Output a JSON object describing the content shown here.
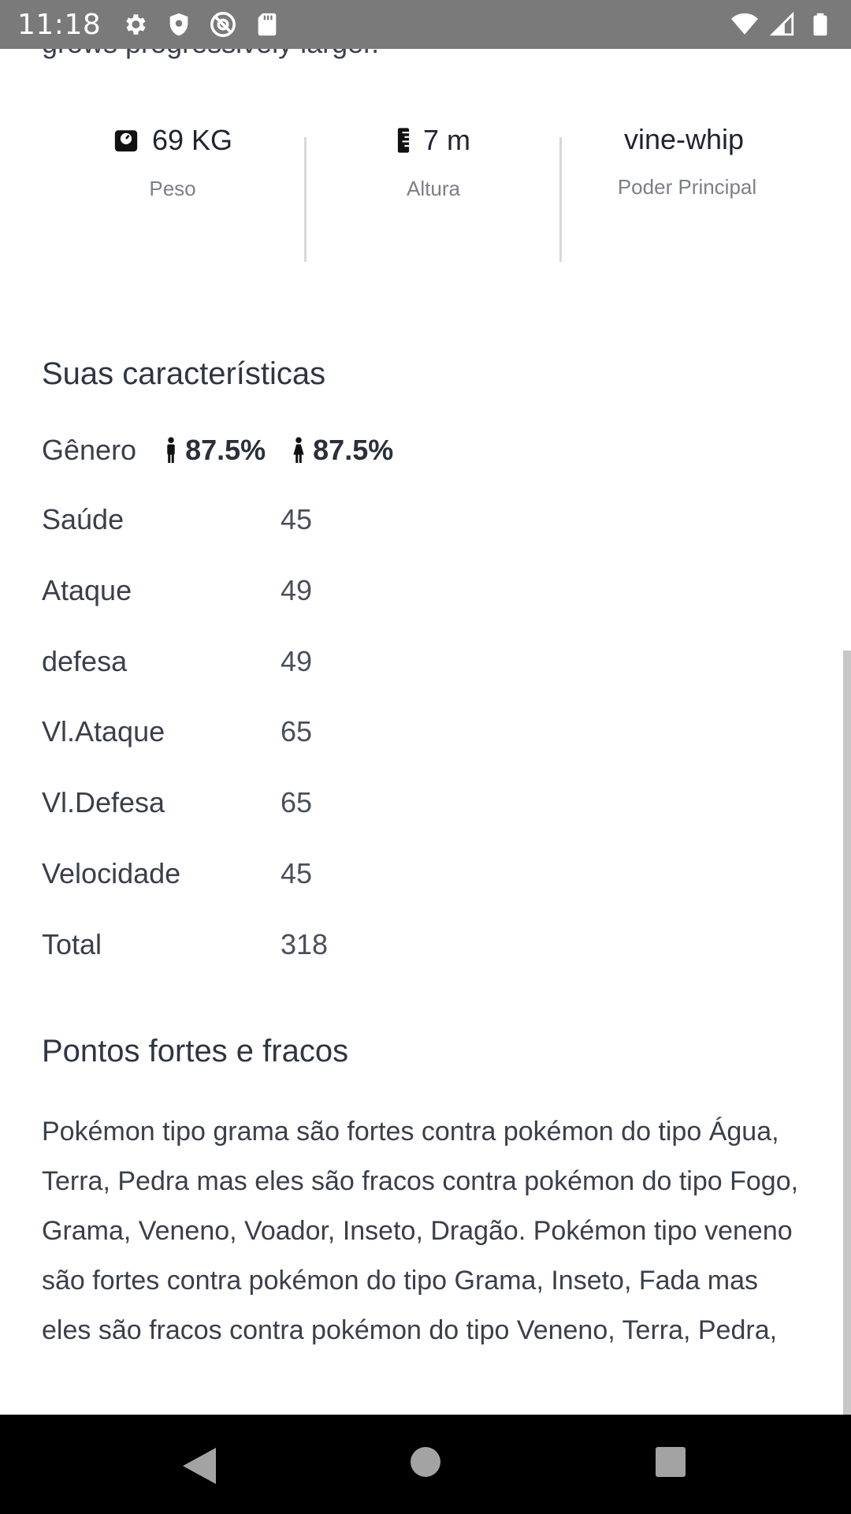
{
  "status_bar": {
    "time": "11:18",
    "icons_left": [
      "gear-icon",
      "shield-icon",
      "at-sign-icon",
      "sd-card-icon"
    ],
    "icons_right": [
      "wifi-icon",
      "signal-icon",
      "battery-icon"
    ]
  },
  "description_clipped": "grows progressively larger.",
  "stats": {
    "weight": {
      "value": "69 KG",
      "label": "Peso",
      "icon": "scale-icon"
    },
    "height": {
      "value": "7 m",
      "label": "Altura",
      "icon": "ruler-icon"
    },
    "power": {
      "value": "vine-whip",
      "label": "Poder Principal"
    }
  },
  "characteristics": {
    "title": "Suas características",
    "gender_label": "Gênero",
    "gender_male": "87.5%",
    "gender_female": "87.5%",
    "attributes": [
      {
        "name": "Saúde",
        "value": "45"
      },
      {
        "name": "Ataque",
        "value": "49"
      },
      {
        "name": "defesa",
        "value": "49"
      },
      {
        "name": "Vl.Ataque",
        "value": "65"
      },
      {
        "name": "Vl.Defesa",
        "value": "65"
      },
      {
        "name": "Velocidade",
        "value": "45"
      },
      {
        "name": "Total",
        "value": "318"
      }
    ]
  },
  "strengths": {
    "title": "Pontos fortes e fracos",
    "text": "Pokémon tipo grama são fortes contra pokémon do tipo Água, Terra, Pedra mas eles são fracos contra pokémon do tipo Fogo, Grama, Veneno, Voador, Inseto, Dragão. Pokémon tipo veneno são fortes contra pokémon do tipo Grama, Inseto, Fada mas eles são fracos contra pokémon do tipo Veneno, Terra, Pedra,"
  },
  "nav_bar": {
    "back": "back-icon",
    "home": "home-icon",
    "recents": "recents-icon"
  }
}
